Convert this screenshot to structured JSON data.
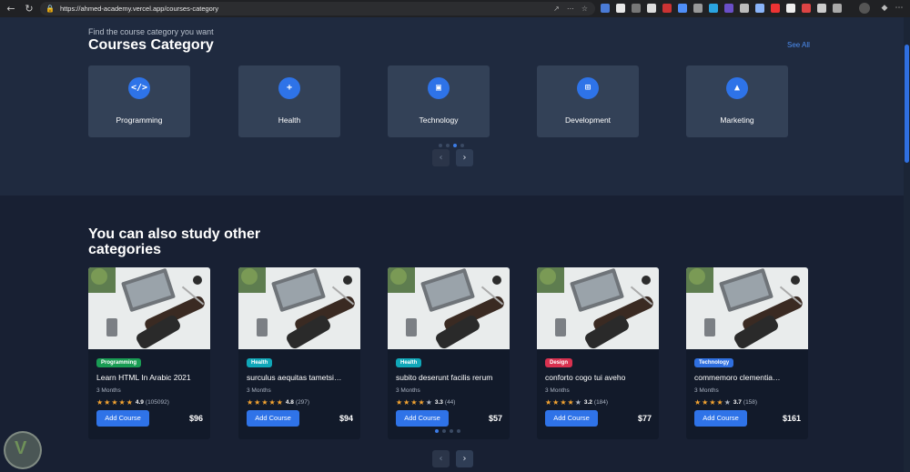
{
  "browser": {
    "url": "https://ahmed-academy.vercel.app/courses-category"
  },
  "section1": {
    "subtitle": "Find the course category you want",
    "title": "Courses Category",
    "see_all": "See All",
    "categories": [
      {
        "label": "Programming",
        "icon": "code-icon",
        "glyph": "</>"
      },
      {
        "label": "Health",
        "icon": "first-aid-kit-icon",
        "glyph": "+"
      },
      {
        "label": "Technology",
        "icon": "cpu-chip-icon",
        "glyph": "▣"
      },
      {
        "label": "Development",
        "icon": "book-plus-icon",
        "glyph": "⊞"
      },
      {
        "label": "Marketing",
        "icon": "chart-icon",
        "glyph": "▲"
      }
    ]
  },
  "section2": {
    "title": "You can also study other categories",
    "courses": [
      {
        "badge": "Programming",
        "badge_color": "#1a9c54",
        "title": "Learn HTML In Arabic 2021",
        "duration": "3 Months",
        "rating": "4.9",
        "stars": 5,
        "reviews": "(105092)",
        "button": "Add Course",
        "price": "$96"
      },
      {
        "badge": "Health",
        "badge_color": "#10a7b8",
        "title": "surculus aequitas tametsi…",
        "duration": "3 Months",
        "rating": "4.8",
        "stars": 5,
        "reviews": "(297)",
        "button": "Add Course",
        "price": "$94"
      },
      {
        "badge": "Health",
        "badge_color": "#10a7b8",
        "title": "subito deserunt facilis rerum",
        "duration": "3 Months",
        "rating": "3.3",
        "stars": 4,
        "reviews": "(44)",
        "button": "Add Course",
        "price": "$57"
      },
      {
        "badge": "Design",
        "badge_color": "#d8314f",
        "title": "conforto cogo tui aveho",
        "duration": "3 Months",
        "rating": "3.2",
        "stars": 4,
        "reviews": "(184)",
        "button": "Add Course",
        "price": "$77"
      },
      {
        "badge": "Technology",
        "badge_color": "#2f6fe0",
        "title": "commemoro clementia…",
        "duration": "3 Months",
        "rating": "3.7",
        "stars": 4,
        "reviews": "(158)",
        "button": "Add Course",
        "price": "$161"
      }
    ]
  },
  "colors": {
    "accent": "#2f73e8",
    "page_bg": "#1b2536",
    "card_bg": "#334157",
    "star": "#f4a431"
  }
}
